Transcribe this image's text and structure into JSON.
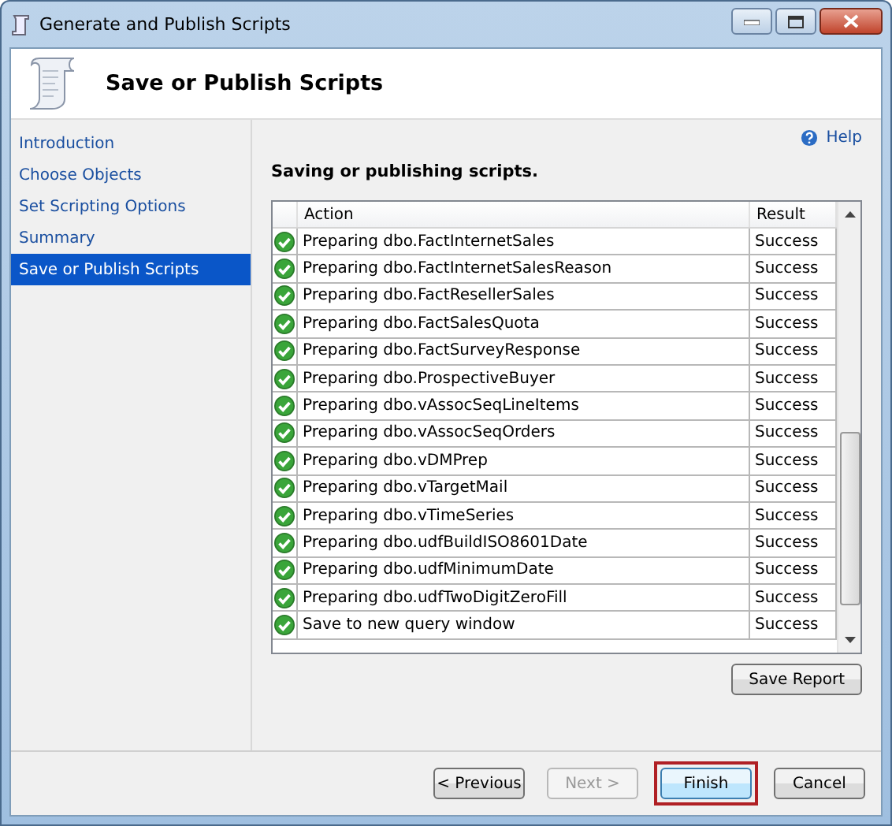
{
  "window": {
    "title": "Generate and Publish Scripts"
  },
  "header": {
    "title": "Save or Publish Scripts"
  },
  "sidebar": {
    "items": [
      {
        "label": "Introduction",
        "selected": false
      },
      {
        "label": "Choose Objects",
        "selected": false
      },
      {
        "label": "Set Scripting Options",
        "selected": false
      },
      {
        "label": "Summary",
        "selected": false
      },
      {
        "label": "Save or Publish Scripts",
        "selected": true
      }
    ]
  },
  "help": {
    "label": "Help"
  },
  "status_text": "Saving or publishing scripts.",
  "table": {
    "columns": [
      "Action",
      "Result"
    ],
    "rows": [
      {
        "succeeded": true,
        "action": "Preparing dbo.FactInternetSales",
        "result": "Success"
      },
      {
        "succeeded": true,
        "action": "Preparing dbo.FactInternetSalesReason",
        "result": "Success"
      },
      {
        "succeeded": true,
        "action": "Preparing dbo.FactResellerSales",
        "result": "Success"
      },
      {
        "succeeded": true,
        "action": "Preparing dbo.FactSalesQuota",
        "result": "Success"
      },
      {
        "succeeded": true,
        "action": "Preparing dbo.FactSurveyResponse",
        "result": "Success"
      },
      {
        "succeeded": true,
        "action": "Preparing dbo.ProspectiveBuyer",
        "result": "Success"
      },
      {
        "succeeded": true,
        "action": "Preparing dbo.vAssocSeqLineItems",
        "result": "Success"
      },
      {
        "succeeded": true,
        "action": "Preparing dbo.vAssocSeqOrders",
        "result": "Success"
      },
      {
        "succeeded": true,
        "action": "Preparing dbo.vDMPrep",
        "result": "Success"
      },
      {
        "succeeded": true,
        "action": "Preparing dbo.vTargetMail",
        "result": "Success"
      },
      {
        "succeeded": true,
        "action": "Preparing dbo.vTimeSeries",
        "result": "Success"
      },
      {
        "succeeded": true,
        "action": "Preparing dbo.udfBuildISO8601Date",
        "result": "Success"
      },
      {
        "succeeded": true,
        "action": "Preparing dbo.udfMinimumDate",
        "result": "Success"
      },
      {
        "succeeded": true,
        "action": "Preparing dbo.udfTwoDigitZeroFill",
        "result": "Success"
      },
      {
        "succeeded": true,
        "action": "Save to new query window",
        "result": "Success"
      }
    ]
  },
  "save_report_button": {
    "label": "Save Report"
  },
  "buttons": [
    {
      "label": "< Previous",
      "disabled": false,
      "highlighted": false
    },
    {
      "label": "Next >",
      "disabled": true,
      "highlighted": false
    },
    {
      "label": "Finish",
      "disabled": false,
      "highlighted": true
    },
    {
      "label": "Cancel",
      "disabled": false,
      "highlighted": false
    }
  ]
}
